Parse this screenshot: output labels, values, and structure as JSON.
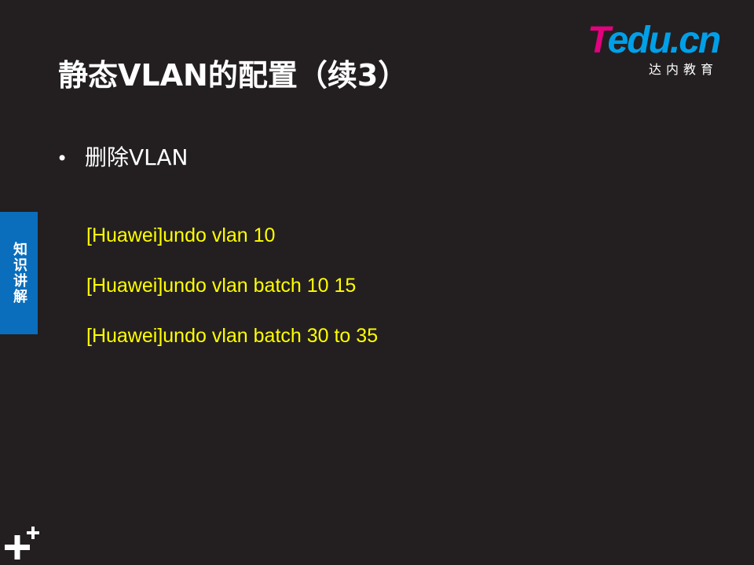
{
  "slide": {
    "title": "静态VLAN的配置（续3）",
    "bullet": "删除VLAN",
    "commands": [
      "[Huawei]undo vlan 10",
      "[Huawei]undo vlan batch 10 15",
      "[Huawei]undo vlan batch 30 to 35"
    ]
  },
  "logo": {
    "mark_first": "T",
    "mark_rest": "edu.cn",
    "subtitle": "达内教育"
  },
  "side_tab": {
    "label": "知识讲解"
  },
  "icons": {
    "bullet": "bullet-dot-icon",
    "corner": "plus-plus-icon"
  },
  "colors": {
    "background": "#231f20",
    "title": "#ffffff",
    "command_text": "#ffff00",
    "side_tab": "#0a6ebd",
    "logo_pink": "#e4007f",
    "logo_blue": "#00a0e9"
  }
}
